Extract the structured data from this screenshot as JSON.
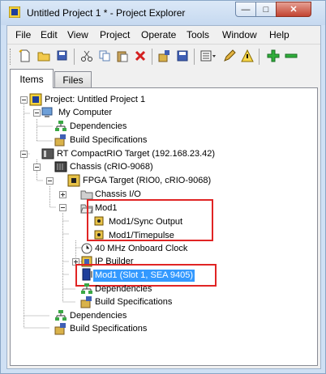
{
  "window": {
    "title": "Untitled Project 1 * - Project Explorer",
    "minimize_glyph": "—",
    "maximize_glyph": "□",
    "close_glyph": "✕"
  },
  "menu": [
    "File",
    "Edit",
    "View",
    "Project",
    "Operate",
    "Tools",
    "Window",
    "Help"
  ],
  "toolbar": {
    "buttons": [
      "new-icon",
      "open-icon",
      "save-all-icon",
      "cut-icon",
      "copy-icon",
      "paste-icon",
      "delete-icon",
      "build-icon",
      "build-spec-icon",
      "view-icon",
      "pen-icon",
      "warning-icon",
      "add-icon",
      "remove-icon"
    ]
  },
  "tabs": {
    "items": "Items",
    "files": "Files"
  },
  "tree": {
    "project": "Project: Untitled Project 1",
    "my_computer": "My Computer",
    "dependencies_1": "Dependencies",
    "build_specs_1": "Build Specifications",
    "rt_target": "RT CompactRIO Target (192.168.23.42)",
    "chassis": "Chassis (cRIO-9068)",
    "fpga_target": "FPGA Target (RIO0, cRIO-9068)",
    "chassis_io": "Chassis I/O",
    "mod1": "Mod1",
    "sync_output": "Mod1/Sync Output",
    "timepulse": "Mod1/Timepulse",
    "clock": "40 MHz Onboard Clock",
    "ip_builder": "IP Builder",
    "mod1_slot": "Mod1 (Slot 1, SEA 9405)",
    "dependencies_2": "Dependencies",
    "build_specs_2": "Build Specifications",
    "dependencies_3": "Dependencies",
    "build_specs_3": "Build Specifications"
  },
  "colors": {
    "selection": "#3399ff",
    "highlight_box": "#e02424",
    "title_bar": "#c6d9f0"
  }
}
